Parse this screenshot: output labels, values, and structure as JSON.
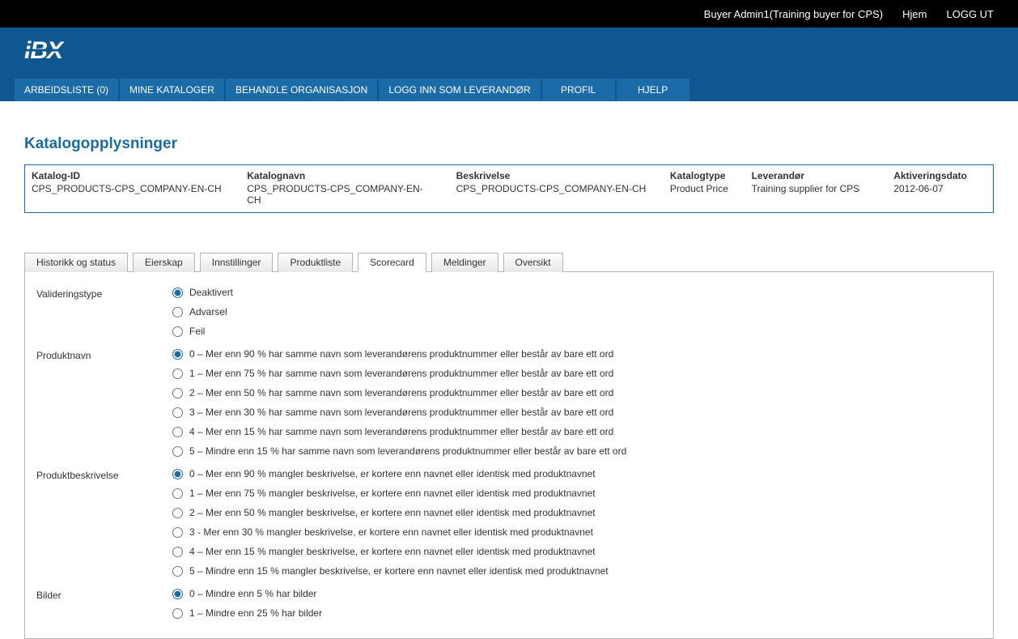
{
  "topbar": {
    "user": "Buyer Admin1(Training buyer for CPS)",
    "home": "Hjem",
    "logout": "LOGG UT"
  },
  "logo": "iBX",
  "nav": [
    "ARBEIDSLISTE (0)",
    "MINE KATALOGER",
    "BEHANDLE ORGANISASJON",
    "LOGG INN SOM LEVERANDØR",
    "PROFIL",
    "HJELP"
  ],
  "page_title": "Katalogopplysninger",
  "info": {
    "labels": {
      "katalog_id": "Katalog-ID",
      "katalognavn": "Katalognavn",
      "beskrivelse": "Beskrivelse",
      "katalogtype": "Katalogtype",
      "leverandor": "Leverandør",
      "aktiveringsdato": "Aktiveringsdato"
    },
    "values": {
      "katalog_id": "CPS_PRODUCTS-CPS_COMPANY-EN-CH",
      "katalognavn": "CPS_PRODUCTS-CPS_COMPANY-EN-CH",
      "beskrivelse": "CPS_PRODUCTS-CPS_COMPANY-EN-CH",
      "katalogtype": "Product Price",
      "leverandor": "Training supplier for CPS",
      "aktiveringsdato": "2012-06-07"
    }
  },
  "tabs": [
    "Historikk og status",
    "Eierskap",
    "Innstillinger",
    "Produktliste",
    "Scorecard",
    "Meldinger",
    "Oversikt"
  ],
  "active_tab_index": 4,
  "sections": {
    "valideringstype": {
      "label": "Valideringstype",
      "options": [
        "Deaktivert",
        "Advarsel",
        "Feil"
      ],
      "selected": 0
    },
    "produktnavn": {
      "label": "Produktnavn",
      "options": [
        "0 – Mer enn 90 % har samme navn som leverandørens produktnummer eller består av bare ett ord",
        "1 – Mer enn 75 % har samme navn som leverandørens produktnummer eller består av bare ett ord",
        "2 – Mer enn 50 % har samme navn som leverandørens produktnummer eller består av bare ett ord",
        "3 – Mer enn 30 % har samme navn som leverandørens produktnummer eller består av bare ett ord",
        "4 – Mer enn 15 % har samme navn som leverandørens produktnummer eller består av bare ett ord",
        "5 – Mindre enn 15 % har samme navn som leverandørens produktnummer eller består av bare ett ord"
      ],
      "selected": 0
    },
    "produktbeskrivelse": {
      "label": "Produktbeskrivelse",
      "options": [
        "0 – Mer enn 90 % mangler beskrivelse, er kortere enn navnet eller identisk med produktnavnet",
        "1 – Mer enn 75 % mangler beskrivelse, er kortere enn navnet eller identisk med produktnavnet",
        "2 – Mer enn 50 % mangler beskrivelse, er kortere enn navnet eller identisk med produktnavnet",
        "3 - Mer enn 30 % mangler beskrivelse, er kortere enn navnet eller identisk med produktnavnet",
        "4 – Mer enn 15 % mangler beskrivelse, er kortere enn navnet eller identisk med produktnavnet",
        "5 – Mindre enn 15 % mangler beskrivelse, er kortere enn navnet eller identisk med produktnavnet"
      ],
      "selected": 0
    },
    "bilder": {
      "label": "Bilder",
      "options": [
        "0 – Mindre enn 5 % har bilder",
        "1 – Mindre enn 25 % har bilder"
      ],
      "selected": 0
    }
  }
}
